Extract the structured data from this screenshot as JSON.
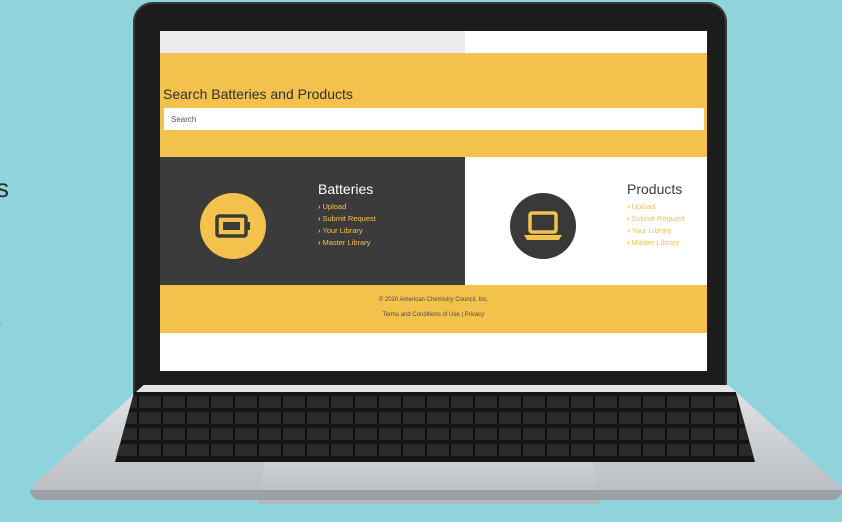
{
  "edge_text": [
    "s",
    ","
  ],
  "page": {
    "search": {
      "title": "Search Batteries and Products",
      "placeholder": "Search",
      "value": ""
    },
    "batteries": {
      "title": "Batteries",
      "icon": "battery-icon",
      "links": [
        "Upload",
        "Submit Request",
        "Your Library",
        "Master Library"
      ]
    },
    "products": {
      "title": "Products",
      "icon": "laptop-icon",
      "links": [
        "Upload",
        "Submit Request",
        "Your Library",
        "Master Library"
      ]
    },
    "footer": {
      "copyright": "© 2020 American Chemistry Council, Inc.",
      "terms": "Terms and Conditions of Use",
      "separator": "|",
      "privacy": "Privacy"
    }
  },
  "colors": {
    "accent_yellow": "#f3c24d",
    "dark_panel": "#3c3b3b",
    "background_teal": "#8fd3dc"
  }
}
